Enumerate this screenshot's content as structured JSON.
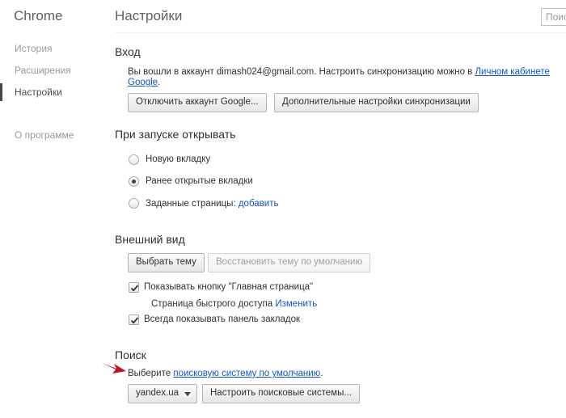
{
  "sidebar": {
    "app_title": "Chrome",
    "items": [
      {
        "label": "История"
      },
      {
        "label": "Расширения"
      },
      {
        "label": "Настройки"
      },
      {
        "label": "О программе"
      }
    ]
  },
  "header": {
    "title": "Настройки",
    "search_placeholder": "Поиск"
  },
  "signin": {
    "title": "Вход",
    "text_before": "Вы вошли в аккаунт dimash024@gmail.com. Настроить синхронизацию можно в ",
    "link_part1": "Личном кабинете",
    "link_part2": "Google",
    "text_after": ".",
    "disconnect_button": "Отключить аккаунт Google...",
    "sync_settings_button": "Дополнительные настройки синхронизации"
  },
  "startup": {
    "title": "При запуске открывать",
    "options": [
      {
        "label": "Новую вкладку",
        "selected": false
      },
      {
        "label": "Ранее открытые вкладки",
        "selected": true
      },
      {
        "label": "Заданные страницы:",
        "selected": false
      }
    ],
    "add_link": "добавить"
  },
  "appearance": {
    "title": "Внешний вид",
    "choose_theme_button": "Выбрать тему",
    "reset_theme_button": "Восстановить тему по умолчанию",
    "show_home_button_label": "Показывать кнопку \"Главная страница\"",
    "show_home_button_checked": true,
    "quick_access_label": "Страница быстрого доступа",
    "change_link": "Изменить",
    "show_bookmarks_label": "Всегда показывать панель закладок",
    "show_bookmarks_checked": true
  },
  "search": {
    "title": "Поиск",
    "text_before": "Выберите ",
    "link": "поисковую систему по умолчанию",
    "text_after": ".",
    "engine_selected": "yandex.ua",
    "manage_button": "Настроить поисковые системы..."
  },
  "colors": {
    "link": "#1155cc",
    "arrow": "#c0161c",
    "active_nav": "#464a4f"
  }
}
